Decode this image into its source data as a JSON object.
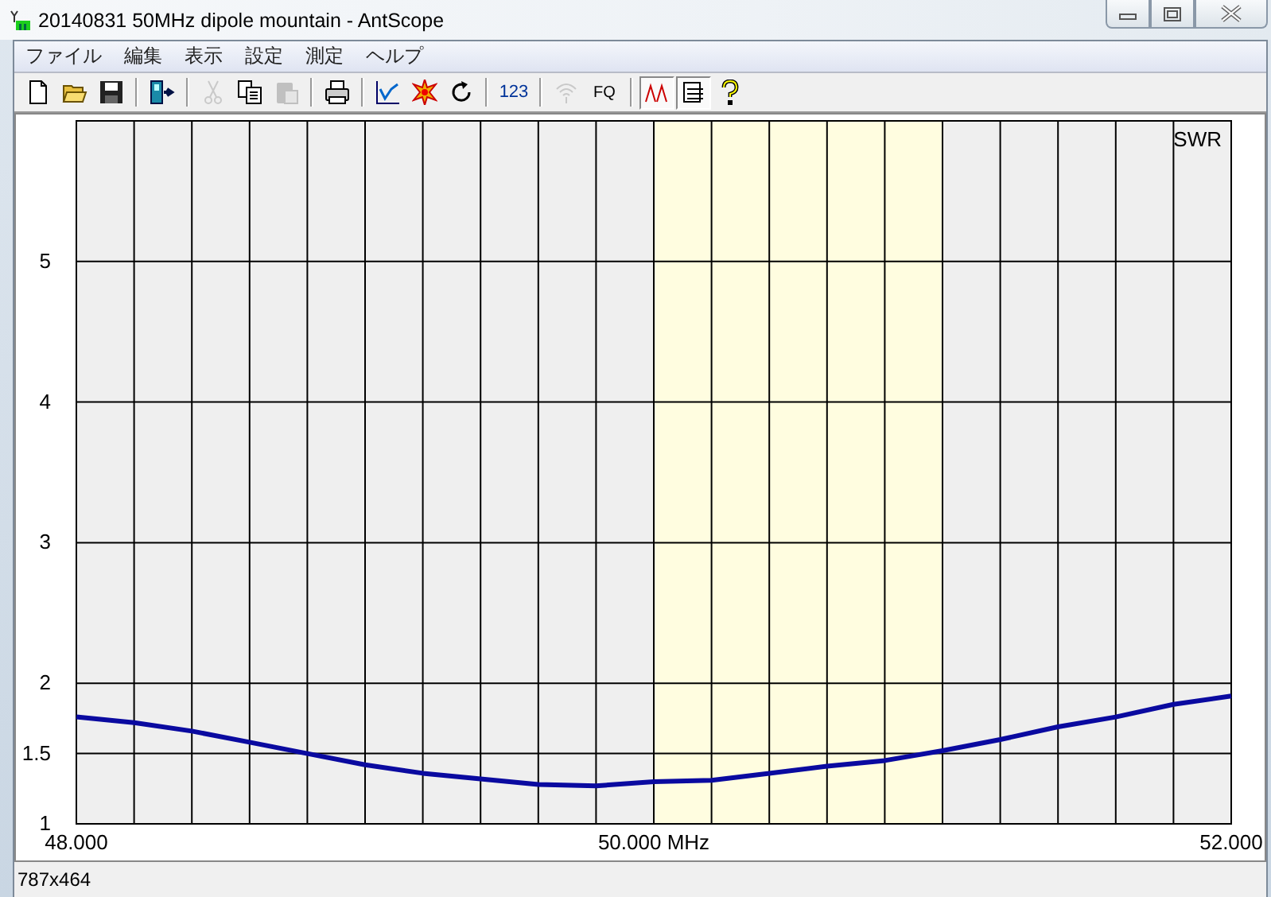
{
  "window": {
    "title": "20140831 50MHz dipole mountain - AntScope"
  },
  "menu": [
    {
      "label": "ファイル"
    },
    {
      "label": "編集"
    },
    {
      "label": "表示"
    },
    {
      "label": "設定"
    },
    {
      "label": "測定"
    },
    {
      "label": "ヘルプ"
    }
  ],
  "toolbar": {
    "groups": [
      [
        {
          "kind": "new",
          "disabled": false,
          "pressed": false
        },
        {
          "kind": "open",
          "disabled": false,
          "pressed": false
        },
        {
          "kind": "save",
          "disabled": false,
          "pressed": false
        }
      ],
      [
        {
          "kind": "export",
          "disabled": false,
          "pressed": false
        }
      ],
      [
        {
          "kind": "cut",
          "disabled": true,
          "pressed": false
        },
        {
          "kind": "copy",
          "disabled": false,
          "pressed": false
        },
        {
          "kind": "paste",
          "disabled": true,
          "pressed": false
        }
      ],
      [
        {
          "kind": "print",
          "disabled": false,
          "pressed": false
        }
      ],
      [
        {
          "kind": "chart",
          "disabled": false,
          "pressed": false
        },
        {
          "kind": "burst",
          "disabled": false,
          "pressed": false
        },
        {
          "kind": "refresh",
          "disabled": false,
          "pressed": false
        }
      ],
      [
        {
          "kind": "text",
          "label": "123",
          "disabled": false,
          "pressed": false
        }
      ],
      [
        {
          "kind": "wireless",
          "disabled": true,
          "pressed": false
        },
        {
          "kind": "text",
          "label": "FQ",
          "disabled": false,
          "pressed": false
        }
      ],
      [
        {
          "kind": "peaks",
          "disabled": false,
          "pressed": true
        },
        {
          "kind": "list",
          "disabled": false,
          "pressed": true
        },
        {
          "kind": "help",
          "disabled": false,
          "pressed": false
        }
      ]
    ]
  },
  "plot": {
    "chart_data": {
      "type": "line",
      "x": [
        48.0,
        48.2,
        48.4,
        48.6,
        48.8,
        49.0,
        49.2,
        49.4,
        49.6,
        49.8,
        50.0,
        50.2,
        50.4,
        50.6,
        50.8,
        51.0,
        51.2,
        51.4,
        51.6,
        51.8,
        52.0
      ],
      "series": [
        {
          "name": "SWR",
          "color": "#0a0aa0",
          "values": [
            1.76,
            1.72,
            1.66,
            1.58,
            1.5,
            1.42,
            1.36,
            1.32,
            1.28,
            1.27,
            1.3,
            1.31,
            1.36,
            1.41,
            1.45,
            1.52,
            1.6,
            1.69,
            1.76,
            1.85,
            1.91
          ]
        }
      ],
      "xlim": [
        48,
        52
      ],
      "ylim": [
        1,
        6
      ],
      "xticks": [
        {
          "value": 48,
          "label": "48.000"
        },
        {
          "value": 50,
          "label": "50.000 MHz"
        },
        {
          "value": 52,
          "label": "52.000"
        }
      ],
      "yticks": [
        1,
        1.5,
        2,
        3,
        4,
        5
      ],
      "grid": true,
      "bands": [
        {
          "axis": "x",
          "from": 50,
          "to": 51
        }
      ]
    }
  },
  "status_bar": {
    "text": "787x464"
  }
}
